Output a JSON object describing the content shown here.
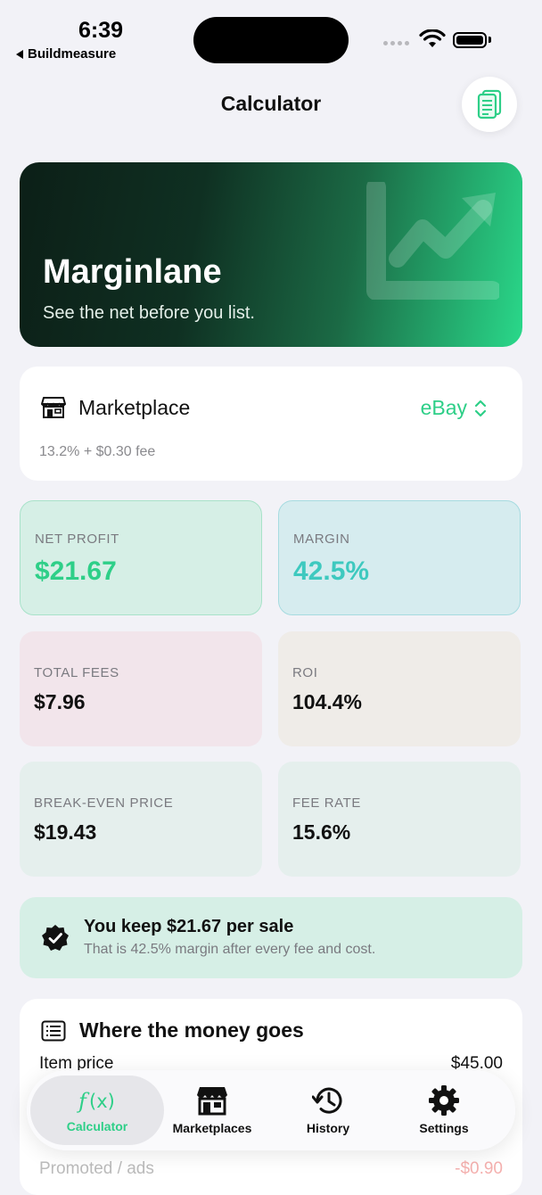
{
  "status_bar": {
    "time": "6:39",
    "back_app": "Buildmeasure"
  },
  "header": {
    "title": "Calculator",
    "doc_button_icon": "document-icon"
  },
  "hero": {
    "title": "Marginlane",
    "subtitle": "See the net before you list."
  },
  "marketplace": {
    "label": "Marketplace",
    "selected": "eBay",
    "fee_text": "13.2% + $0.30 fee"
  },
  "metrics": {
    "net_profit": {
      "label": "Net profit",
      "value": "$21.67"
    },
    "margin": {
      "label": "Margin",
      "value": "42.5%"
    },
    "total_fees": {
      "label": "Total fees",
      "value": "$7.96"
    },
    "roi": {
      "label": "ROI",
      "value": "104.4%"
    },
    "break_even": {
      "label": "Break-even price",
      "value": "$19.43"
    },
    "fee_rate": {
      "label": "Fee rate",
      "value": "15.6%"
    }
  },
  "keep_banner": {
    "title": "You keep $21.67 per sale",
    "subtitle": "That is 42.5% margin after every fee and cost."
  },
  "money": {
    "title": "Where the money goes",
    "rows": [
      {
        "label": "Item price",
        "value": "$45.00"
      },
      {
        "label": "Promoted / ads",
        "value": "-$0.90"
      }
    ]
  },
  "tabbar": {
    "tabs": [
      {
        "label": "Calculator",
        "icon": "function-icon",
        "active": true
      },
      {
        "label": "Marketplaces",
        "icon": "storefront-icon",
        "active": false
      },
      {
        "label": "History",
        "icon": "clock-history-icon",
        "active": false
      },
      {
        "label": "Settings",
        "icon": "gear-icon",
        "active": false
      }
    ]
  },
  "colors": {
    "accent": "#2ecf88",
    "margin_accent": "#3ec9bf",
    "background": "#f2f2f7"
  }
}
